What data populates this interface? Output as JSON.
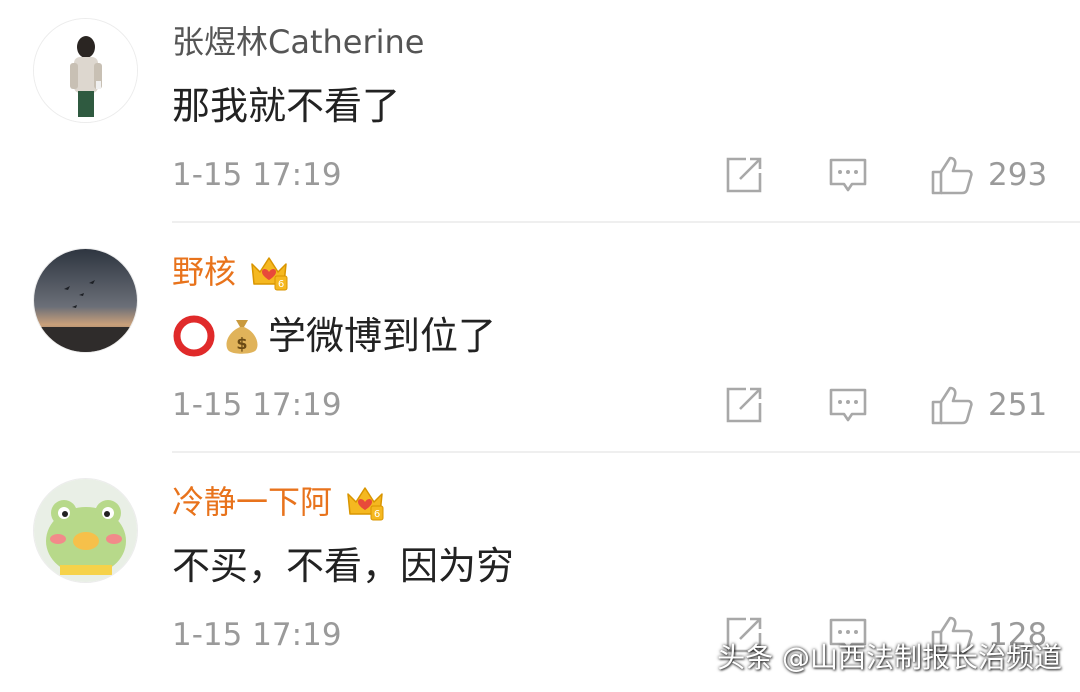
{
  "comments": [
    {
      "username": "张煜林Catherine",
      "vip": false,
      "text": "那我就不看了",
      "emojis": [],
      "time": "1-15 17:19",
      "likes": "293"
    },
    {
      "username": "野核",
      "vip": true,
      "text": "学微博到位了",
      "emojis": [
        "red-circle-emoji",
        "money-bag-emoji"
      ],
      "time": "1-15 17:19",
      "likes": "251"
    },
    {
      "username": "冷静一下阿",
      "vip": true,
      "text": "不买，不看，因为穷",
      "emojis": [],
      "time": "1-15 17:19",
      "likes": "128"
    }
  ],
  "watermark": "头条 @山西法制报长治频道",
  "colors": {
    "vip_name": "#e8731c",
    "normal_name": "#555555",
    "meta": "#9a9a9a",
    "crown_gold": "#f5b820",
    "crown_red": "#e84a3a"
  },
  "icons": [
    "share-icon",
    "reply-icon",
    "like-icon",
    "crown-badge-icon"
  ]
}
